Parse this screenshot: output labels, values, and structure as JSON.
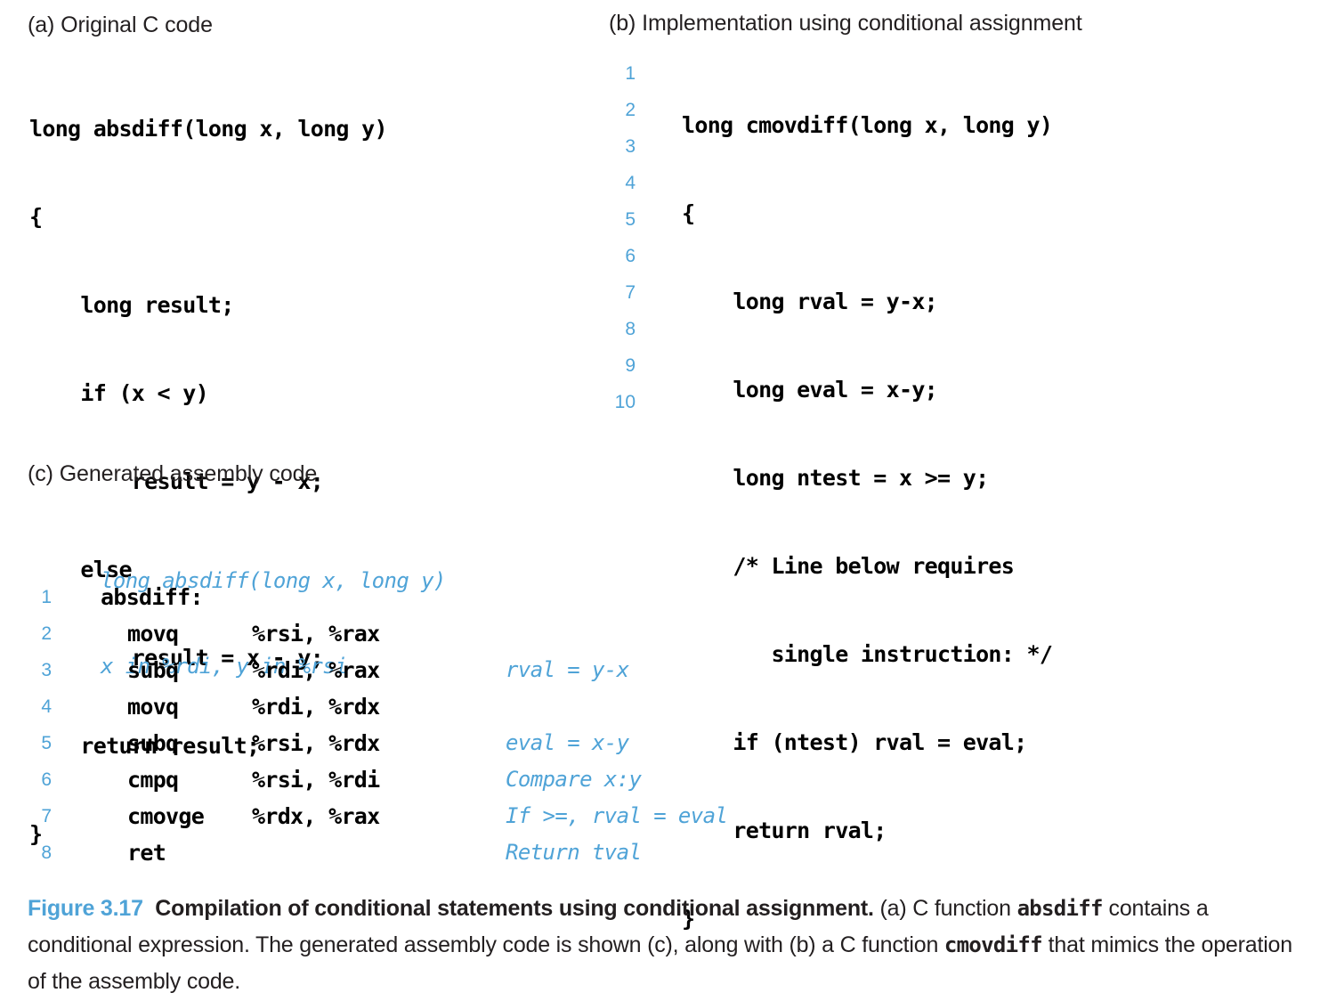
{
  "colors": {
    "accent_blue": "#4fa3d7",
    "text_black": "#231f20",
    "background": "#ffffff"
  },
  "panel_a": {
    "heading": "(a) Original C code",
    "code_lines": [
      "long absdiff(long x, long y)",
      "{",
      "    long result;",
      "    if (x < y)",
      "        result = y - x;",
      "    else",
      "        result = x - y;",
      "    return result;",
      "}"
    ]
  },
  "panel_b": {
    "heading": "(b) Implementation using conditional assignment",
    "line_numbers": [
      "1",
      "2",
      "3",
      "4",
      "5",
      "6",
      "7",
      "8",
      "9",
      "10"
    ],
    "code_lines": [
      "long cmovdiff(long x, long y)",
      "{",
      "    long rval = y-x;",
      "    long eval = x-y;",
      "    long ntest = x >= y;",
      "    /* Line below requires",
      "       single instruction: */",
      "    if (ntest) rval = eval;",
      "    return rval;",
      "}"
    ]
  },
  "panel_c": {
    "heading": "(c) Generated assembly code",
    "description_lines": [
      "long absdiff(long x, long y)",
      "x in %rdi, y in %rsi"
    ],
    "rows": [
      {
        "num": "1",
        "label": "absdiff:",
        "mnemonic": "",
        "operands": "",
        "comment": ""
      },
      {
        "num": "2",
        "label": "",
        "mnemonic": "movq",
        "operands": "%rsi, %rax",
        "comment": ""
      },
      {
        "num": "3",
        "label": "",
        "mnemonic": "subq",
        "operands": "%rdi, %rax",
        "comment": "rval = y-x"
      },
      {
        "num": "4",
        "label": "",
        "mnemonic": "movq",
        "operands": "%rdi, %rdx",
        "comment": ""
      },
      {
        "num": "5",
        "label": "",
        "mnemonic": "subq",
        "operands": "%rsi, %rdx",
        "comment": "eval = x-y"
      },
      {
        "num": "6",
        "label": "",
        "mnemonic": "cmpq",
        "operands": "%rsi, %rdi",
        "comment": "Compare x:y"
      },
      {
        "num": "7",
        "label": "",
        "mnemonic": "cmovge",
        "operands": "%rdx, %rax",
        "comment": "If >=, rval = eval"
      },
      {
        "num": "8",
        "label": "",
        "mnemonic": "ret",
        "operands": "",
        "comment": "Return tval"
      }
    ]
  },
  "caption": {
    "figure_label": "Figure 3.17",
    "title": "Compilation of conditional statements using conditional assignment.",
    "body_part1": " (a) C function ",
    "mono1": "absdiff",
    "body_part2": " contains a conditional expression. The generated assembly code is shown (c), along with (b) a C function ",
    "mono2": "cmovdiff",
    "body_part3": " that mimics the operation of the assembly code."
  }
}
